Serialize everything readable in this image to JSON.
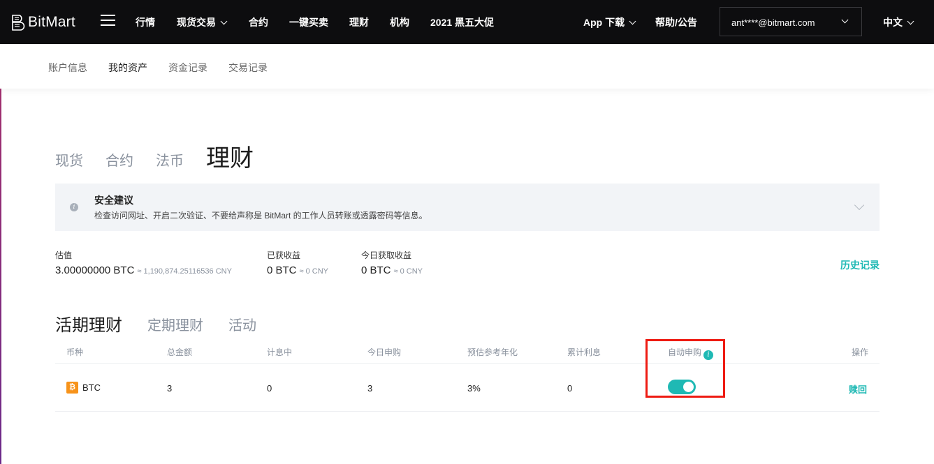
{
  "header": {
    "logo_text": "BitMart",
    "nav": [
      "行情",
      "现货交易",
      "合约",
      "一键买卖",
      "理财",
      "机构",
      "2021 黑五大促"
    ],
    "app_download": "App 下载",
    "help": "帮助/公告",
    "account": "ant****@bitmart.com",
    "language": "中文"
  },
  "subnav": [
    "账户信息",
    "我的资产",
    "资金记录",
    "交易记录"
  ],
  "asset_tabs": [
    "现货",
    "合约",
    "法币",
    "理财"
  ],
  "advice": {
    "title": "安全建议",
    "desc": "检查访问网址、开启二次验证、不要给声称是 BitMart 的工作人员转账或透露密码等信息。"
  },
  "stats": {
    "estimate": {
      "label": "估值",
      "value": "3.00000000 BTC",
      "sub": "≈ 1,190,874.25116536 CNY"
    },
    "earned": {
      "label": "已获收益",
      "value": "0 BTC",
      "sub": "≈ 0 CNY"
    },
    "today": {
      "label": "今日获取收益",
      "value": "0 BTC",
      "sub": "≈ 0 CNY"
    },
    "history": "历史记录"
  },
  "earn_tabs": [
    "活期理财",
    "定期理财",
    "活动"
  ],
  "table": {
    "headers": [
      "币种",
      "总金额",
      "计息中",
      "今日申购",
      "预估参考年化",
      "累计利息",
      "自动申购",
      "操作"
    ],
    "row": {
      "coin": "BTC",
      "total": "3",
      "interest_bearing": "0",
      "today_subscribe": "3",
      "apy": "3%",
      "accumulated": "0",
      "auto_subscribe": true,
      "action": "赎回"
    }
  },
  "colors": {
    "accent": "#1fb9b4",
    "topbar": "#0d0d0f",
    "highlight": "#ee1b12",
    "btc": "#f7931a"
  }
}
